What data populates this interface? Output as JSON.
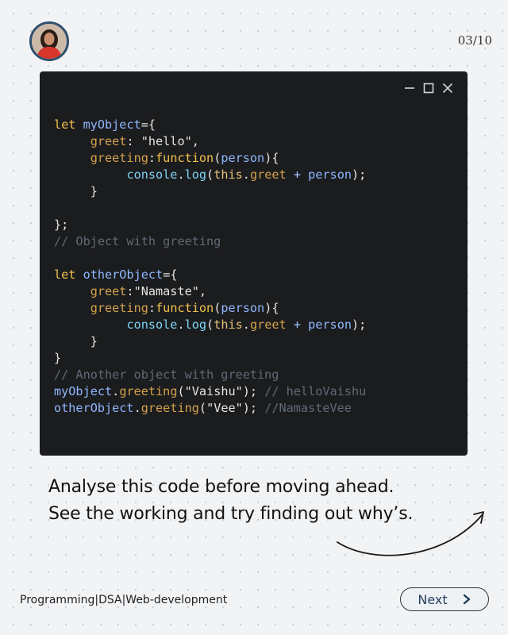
{
  "header": {
    "page_counter": "03/10",
    "avatar_icon": "person-avatar"
  },
  "window": {
    "controls": [
      "minimize-icon",
      "maximize-icon",
      "close-icon"
    ],
    "background": "#1b1c1e"
  },
  "code": {
    "lines": [
      "let myObject={",
      "     greet: \"hello\",",
      "     greeting:function(person){",
      "          console.log(this.greet + person);",
      "     }",
      "",
      "};",
      "// Object with greeting",
      "",
      "let otherObject={",
      "     greet:\"Namaste\",",
      "     greeting:function(person){",
      "          console.log(this.greet + person);",
      "     }",
      "}",
      "// Another object with greeting",
      "myObject.greeting(\"Vaishu\"); // helloVaishu",
      "otherObject.greeting(\"Vee\"); //NamasteVee"
    ]
  },
  "caption": {
    "line1": "Analyse this code before moving ahead.",
    "line2": "See the working and try finding out why’s."
  },
  "footer": {
    "tagline": "Programming|DSA|Web-development",
    "next_label": "Next",
    "next_icon": "chevron-right-icon"
  },
  "colors": {
    "background": "#f1f3f5",
    "keyword": "#f2c14e",
    "variable": "#8fb7ff",
    "comment": "#5f6a76"
  }
}
